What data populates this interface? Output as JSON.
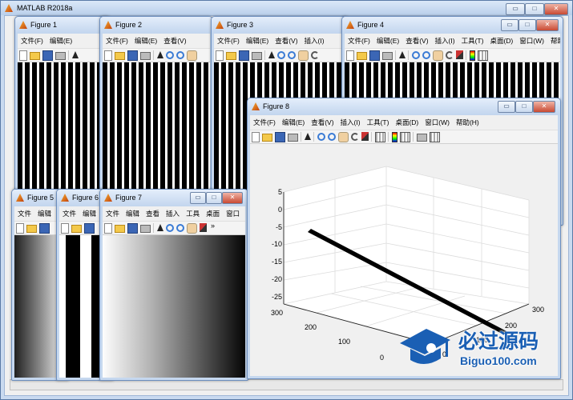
{
  "main_window": {
    "title": "MATLAB R2018a"
  },
  "fig_menu_full": [
    "文件(F)",
    "编辑(E)",
    "查看(V)",
    "插入(I)",
    "工具(T)",
    "桌面(D)",
    "窗口(W)",
    "帮助(H)"
  ],
  "fig_menu_short": [
    "文件",
    "编辑",
    "查看",
    "插入",
    "工具",
    "桌面",
    "窗口",
    "帮助"
  ],
  "figures": {
    "f1": {
      "title": "Figure 1"
    },
    "f2": {
      "title": "Figure 2"
    },
    "f3": {
      "title": "Figure 3"
    },
    "f4": {
      "title": "Figure 4"
    },
    "f5": {
      "title": "Figure 5"
    },
    "f6": {
      "title": "Figure 6"
    },
    "f7": {
      "title": "Figure 7"
    },
    "f8": {
      "title": "Figure 8"
    }
  },
  "window_controls": {
    "minimize": "▭",
    "maximize": "□",
    "close": "✕"
  },
  "toolbar_more": "»",
  "plot3d": {
    "z_ticks": [
      "5",
      "0",
      "-5",
      "-10",
      "-15",
      "-20",
      "-25"
    ],
    "y_ticks": [
      "300",
      "200",
      "100",
      "0"
    ],
    "x_ticks": [
      "300",
      "200",
      "100",
      "0"
    ]
  },
  "watermark": {
    "name": "必过源码",
    "url": "Biguo100.com"
  },
  "colors": {
    "accent": "#1a5fb4",
    "titlebar": "#c2d5ee"
  }
}
